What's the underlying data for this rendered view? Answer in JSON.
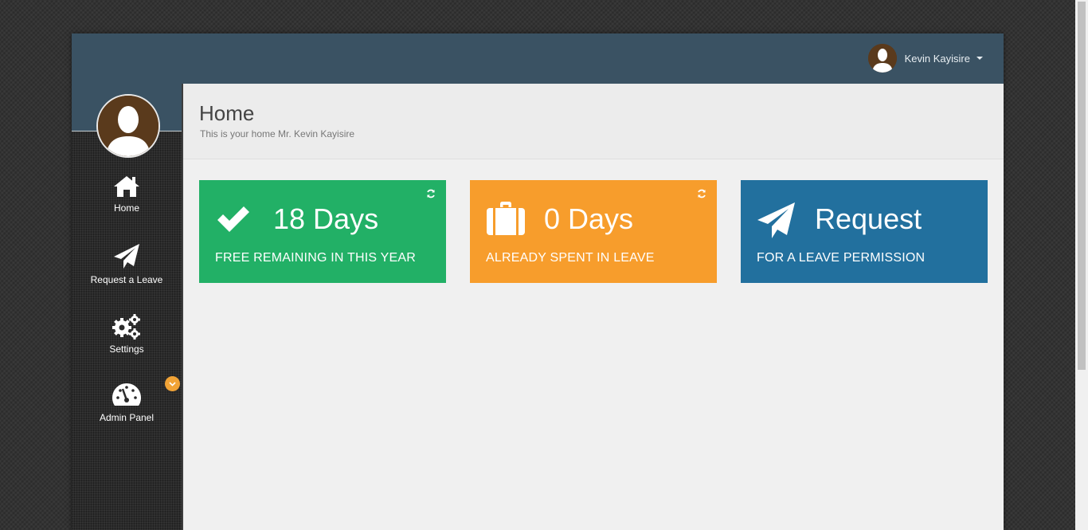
{
  "header": {
    "user_name": "Kevin Kayisire"
  },
  "sidebar": {
    "items": [
      {
        "label": "Home",
        "icon": "home-icon"
      },
      {
        "label": "Request a Leave",
        "icon": "paper-plane-icon"
      },
      {
        "label": "Settings",
        "icon": "gears-icon"
      },
      {
        "label": "Admin Panel",
        "icon": "dashboard-icon",
        "badge_icon": "chevron-down-icon"
      }
    ]
  },
  "page": {
    "title": "Home",
    "subtitle": "This is your home Mr. Kevin Kayisire"
  },
  "tiles": [
    {
      "value": "18 Days",
      "label": "FREE REMAINING IN THIS YEAR",
      "icon": "check-icon",
      "color": "#22b066"
    },
    {
      "value": "0 Days",
      "label": "ALREADY SPENT IN LEAVE",
      "icon": "briefcase-icon",
      "color": "#f79d2c"
    },
    {
      "value": "Request",
      "label": "FOR A LEAVE PERMISSION",
      "icon": "paper-plane-icon",
      "color": "#22709e"
    }
  ],
  "colors": {
    "topbar": "#3a5263",
    "sidebar": "#2b2b2b",
    "badge": "#f1a336"
  }
}
